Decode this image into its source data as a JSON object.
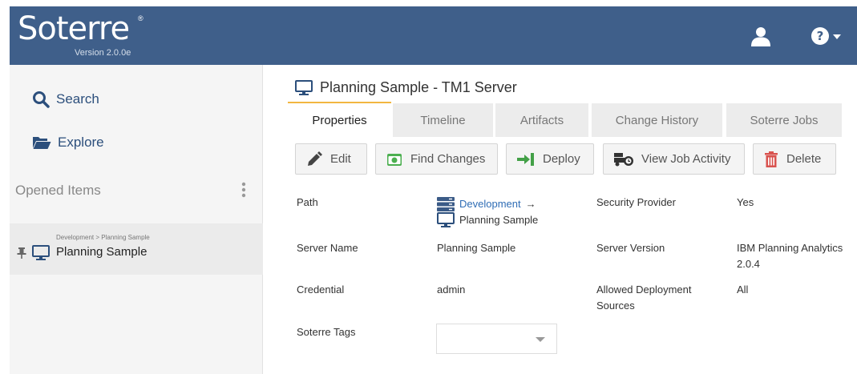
{
  "header": {
    "logo": "Soterre",
    "logo_mark": "®",
    "version": "Version 2.0.0e",
    "bg_color": "#3f5f8a"
  },
  "sidebar": {
    "search_label": "Search",
    "explore_label": "Explore",
    "opened_items_title": "Opened Items",
    "opened_items": [
      {
        "breadcrumb": "Development > Planning Sample",
        "label": "Planning Sample"
      }
    ]
  },
  "main": {
    "title": "Planning Sample - TM1 Server",
    "tabs": [
      {
        "label": "Properties",
        "active": true
      },
      {
        "label": "Timeline",
        "active": false
      },
      {
        "label": "Artifacts",
        "active": false
      },
      {
        "label": "Change History",
        "active": false
      },
      {
        "label": "Soterre Jobs",
        "active": false
      }
    ],
    "toolbar": {
      "edit": "Edit",
      "find_changes": "Find Changes",
      "deploy": "Deploy",
      "view_job_activity": "View Job Activity",
      "delete": "Delete"
    },
    "properties": {
      "path_label": "Path",
      "path_parent": "Development",
      "path_arrow": "→",
      "path_leaf": "Planning Sample",
      "server_name_label": "Server Name",
      "server_name": "Planning Sample",
      "credential_label": "Credential",
      "credential": "admin",
      "tags_label": "Soterre Tags",
      "tags_value": "",
      "security_provider_label": "Security Provider",
      "security_provider": "Yes",
      "server_version_label": "Server Version",
      "server_version_line1": "IBM Planning Analytics",
      "server_version_line2": "2.0.4",
      "allowed_sources_label_line1": "Allowed Deployment",
      "allowed_sources_label_line2": "Sources",
      "allowed_sources": "All"
    }
  },
  "colors": {
    "accent_tab": "#f2b640",
    "link": "#2f6db5",
    "nav": "#2c4f7c",
    "delete_red": "#d9534f",
    "find_green": "#4caf50",
    "deploy_green": "#43a047"
  },
  "icons": {
    "user": "user-icon",
    "help": "help-icon",
    "search": "search-icon",
    "explore": "folder-open-icon",
    "kebab": "kebab-menu-icon",
    "pin": "pin-icon",
    "monitor": "monitor-icon",
    "edit": "pencil-icon",
    "find": "camera-icon",
    "deploy": "deploy-arrow-icon",
    "jobs": "truck-icon",
    "delete": "trash-icon",
    "server": "server-icon"
  }
}
